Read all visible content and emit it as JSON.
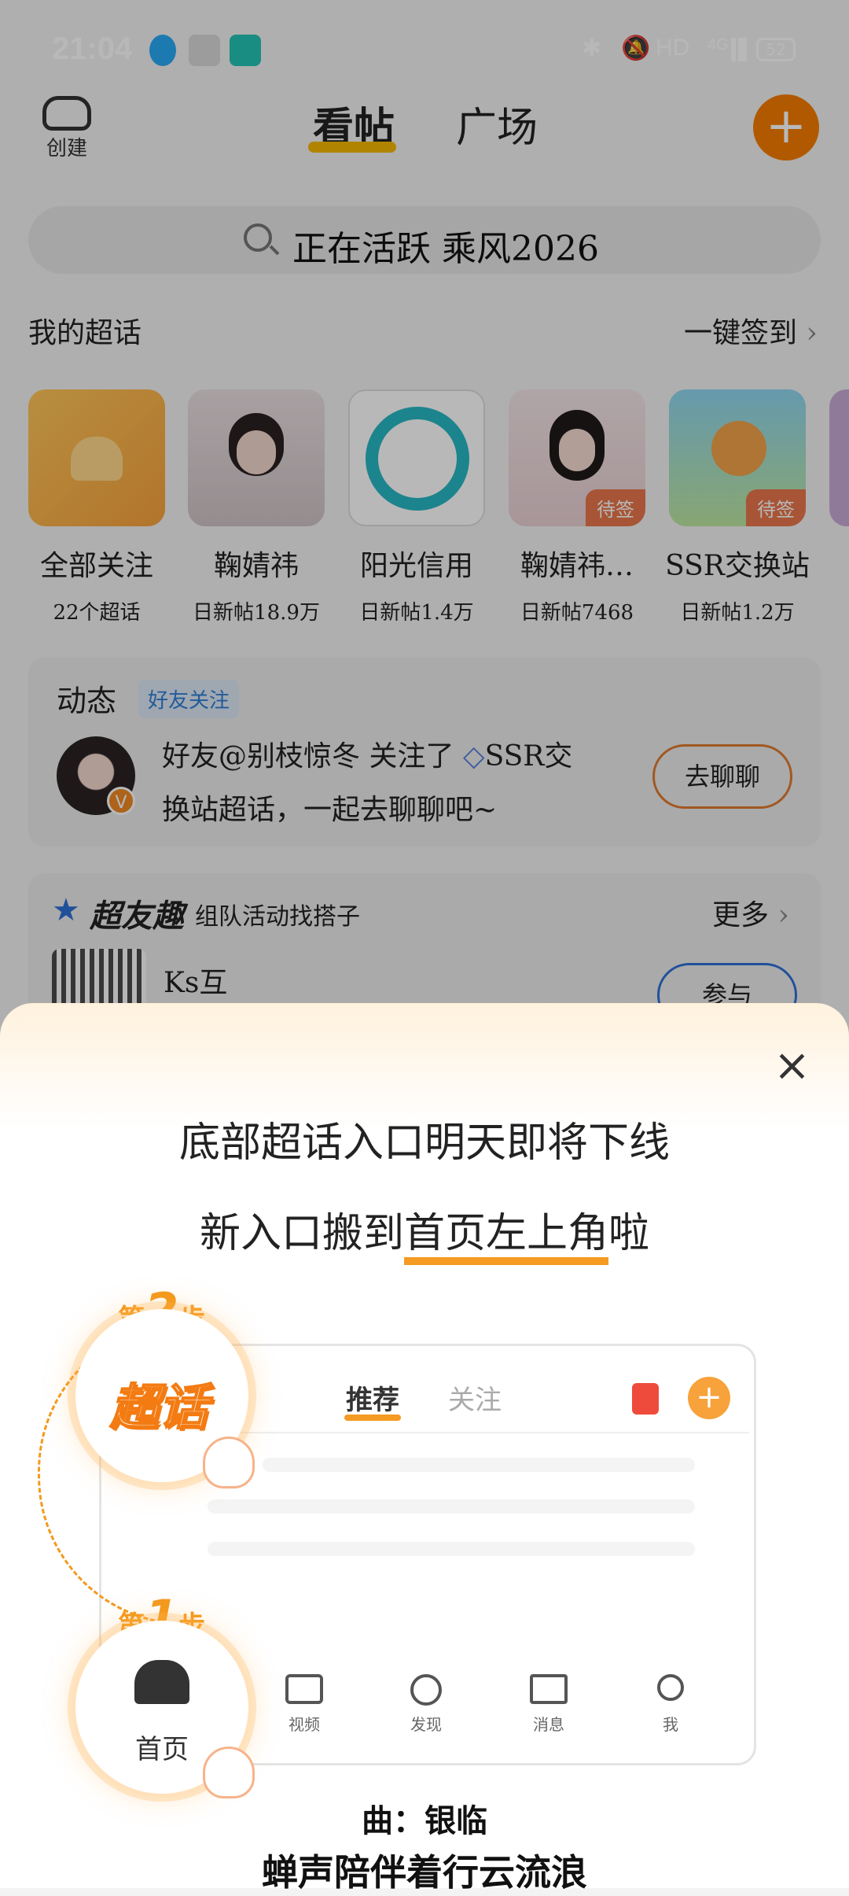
{
  "status_bar": {
    "time": "21:04",
    "right_text": "HD",
    "network": "4G",
    "battery": "52"
  },
  "top_nav": {
    "create_label": "创建",
    "tabs": [
      "看帖",
      "广场"
    ],
    "plus_label": "+"
  },
  "search": {
    "placeholder": "正在活跃 乘风2026"
  },
  "my_topics": {
    "title": "我的超话",
    "sign_all": "一键签到",
    "items": [
      {
        "name": "全部关注",
        "sub": "22个超话",
        "badge": ""
      },
      {
        "name": "鞠婧祎",
        "sub": "日新帖18.9万",
        "badge": ""
      },
      {
        "name": "阳光信用",
        "sub": "日新帖1.4万",
        "badge": ""
      },
      {
        "name": "鞠婧祎…",
        "sub": "日新帖7468",
        "badge": "待签"
      },
      {
        "name": "SSR交换站",
        "sub": "日新帖1.2万",
        "badge": "待签"
      }
    ]
  },
  "dynamic": {
    "title": "动态",
    "tag": "好友关注",
    "message_line1": "好友@别枝惊冬 关注了",
    "message_topic": "SSR交",
    "message_line2": "换站超话，一起去聊聊吧~",
    "action": "去聊聊"
  },
  "super_friends": {
    "title": "超友趣",
    "subtitle": "组队活动找搭子",
    "more": "更多",
    "item_name": "Ks互",
    "action": "参与"
  },
  "sheet": {
    "close": "×",
    "line1": "底部超话入口明天即将下线",
    "line2_prefix": "新入口搬到",
    "line2_highlight": "首页左上角",
    "line2_suffix": "啦",
    "step_word": "第",
    "step_unit": "步",
    "step2_number": "2",
    "step1_number": "1",
    "step2_label": "超话",
    "step1_label": "首页",
    "mock_tabs": [
      "推荐",
      "关注"
    ],
    "mock_nav": [
      "视频",
      "发现",
      "消息",
      "我"
    ]
  },
  "lyrics": {
    "line1": "曲：银临",
    "line2": "蝉声陪伴着行云流浪"
  },
  "colors": {
    "accent": "#f57c00",
    "highlight": "#f59a23",
    "tab_underline": "#f6b800"
  }
}
